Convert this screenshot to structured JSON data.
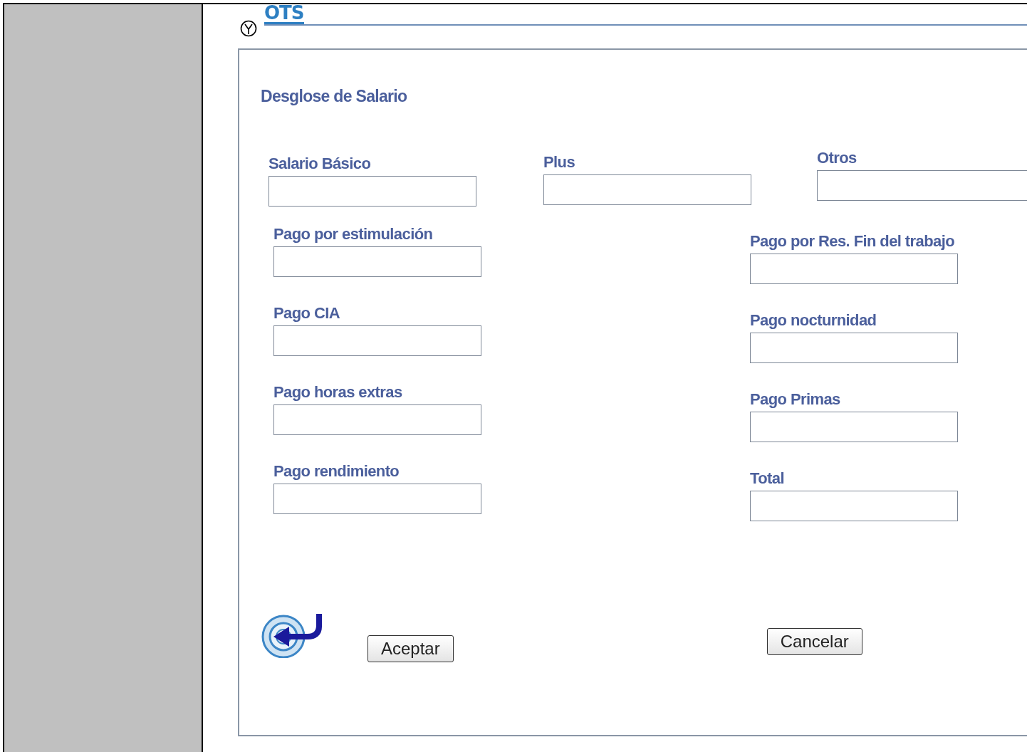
{
  "header": {
    "logo": "OTS"
  },
  "form": {
    "title": "Desglose de Salario",
    "top_fields": [
      {
        "label": "Salario Básico"
      },
      {
        "label": "Plus"
      },
      {
        "label": "Otros"
      }
    ],
    "left_fields": [
      {
        "label": "Pago por estimulación"
      },
      {
        "label": "Pago CIA"
      },
      {
        "label": "Pago horas extras"
      },
      {
        "label": "Pago rendimiento"
      }
    ],
    "right_fields": [
      {
        "label": "Pago por Res. Fin del trabajo"
      },
      {
        "label": "Pago nocturnidad"
      },
      {
        "label": "Pago Primas"
      },
      {
        "label": "Total"
      }
    ],
    "buttons": [
      {
        "label": "Aceptar"
      },
      {
        "label": "Cancelar"
      }
    ]
  }
}
